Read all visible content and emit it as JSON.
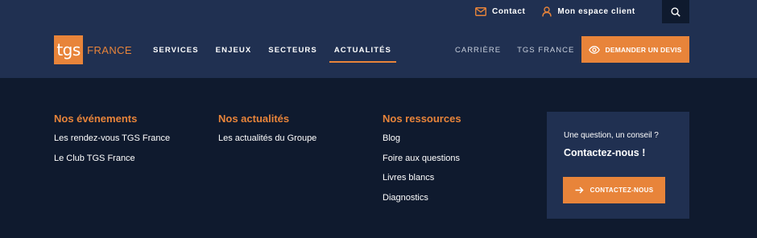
{
  "topbar": {
    "contact_label": "Contact",
    "account_label": "Mon espace client"
  },
  "logo": {
    "mark": "tgs",
    "word": "FRANCE"
  },
  "main_nav": [
    {
      "label": "SERVICES"
    },
    {
      "label": "ENJEUX"
    },
    {
      "label": "SECTEURS"
    },
    {
      "label": "ACTUALITÉS",
      "active": true
    }
  ],
  "secondary_nav": [
    {
      "label": "CARRIÈRE"
    },
    {
      "label": "TGS FRANCE"
    }
  ],
  "cta": {
    "label": "DEMANDER UN DEVIS",
    "icon": "eye-icon"
  },
  "menu": {
    "columns": [
      {
        "title": "Nos événements",
        "links": [
          "Les rendez-vous TGS France",
          "Le Club TGS France"
        ]
      },
      {
        "title": "Nos actualités",
        "links": [
          "Les actualités du Groupe"
        ]
      },
      {
        "title": "Nos ressources",
        "links": [
          "Blog",
          "Foire aux questions",
          "Livres blancs",
          "Diagnostics"
        ]
      }
    ],
    "card": {
      "question": "Une question, un conseil ?",
      "title": "Contactez-nous !",
      "button_label": "CONTACTEZ-NOUS",
      "button_icon": "arrow-right-icon"
    }
  },
  "colors": {
    "header_bg": "#203051",
    "page_bg": "#0f1a2e",
    "accent": "#e8843a"
  }
}
